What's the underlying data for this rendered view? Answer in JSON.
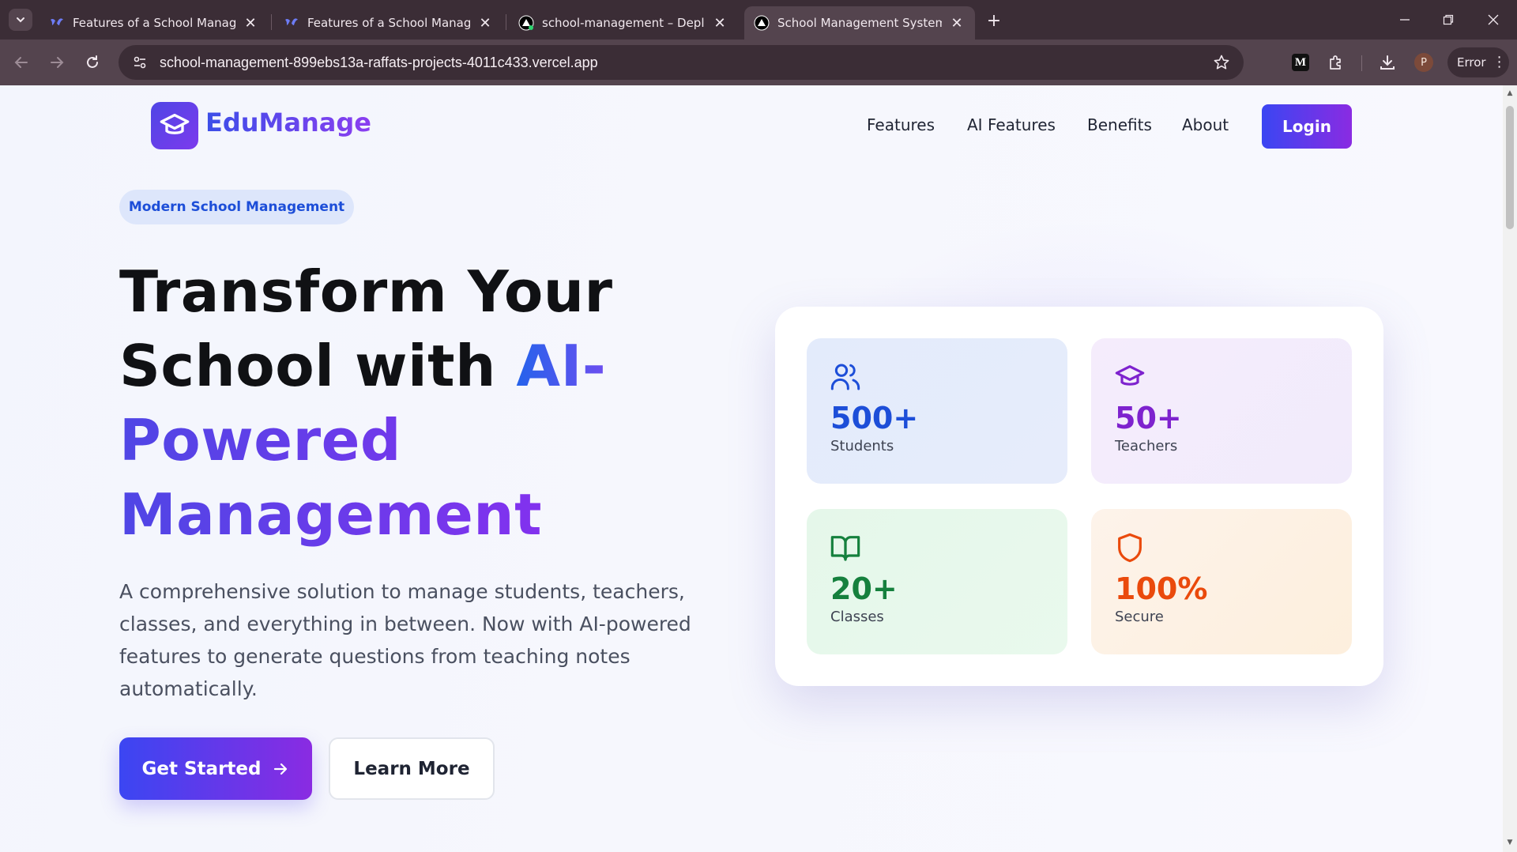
{
  "browser": {
    "tabs": [
      {
        "title": "Features of a School Management",
        "active": false
      },
      {
        "title": "Features of a School Management",
        "active": false
      },
      {
        "title": "school-management – Deployment",
        "active": false
      },
      {
        "title": "School Management System",
        "active": true
      }
    ],
    "url": "school-management-899ebs13a-raffats-projects-4011c433.vercel.app",
    "profile_initial": "P",
    "status_label": "Error",
    "extension_label": "M"
  },
  "nav": {
    "brand": "EduManage",
    "links": [
      "Features",
      "AI Features",
      "Benefits",
      "About"
    ],
    "login_label": "Login"
  },
  "hero": {
    "badge": "Modern School Management",
    "headline": {
      "line1": "Transform Your",
      "line2_plain": "School with ",
      "line2_accent": "AI-",
      "line3": "Powered",
      "line4": "Management"
    },
    "description": "A comprehensive solution to manage students, teachers, classes, and everything in between. Now with AI-powered features to generate questions from teaching notes automatically.",
    "primary_cta": "Get Started",
    "secondary_cta": "Learn More"
  },
  "stats": [
    {
      "value": "500+",
      "label": "Students",
      "icon": "users-icon",
      "color": "#1d4ed8"
    },
    {
      "value": "50+",
      "label": "Teachers",
      "icon": "graduation-cap-icon",
      "color": "#7e22ce"
    },
    {
      "value": "20+",
      "label": "Classes",
      "icon": "book-open-icon",
      "color": "#15803d"
    },
    {
      "value": "100%",
      "label": "Secure",
      "icon": "shield-icon",
      "color": "#ea4a0c"
    }
  ],
  "colors": {
    "brand_gradient_start": "#3b46f2",
    "brand_gradient_end": "#8a2be2",
    "browser_frame": "#3b2d36"
  }
}
